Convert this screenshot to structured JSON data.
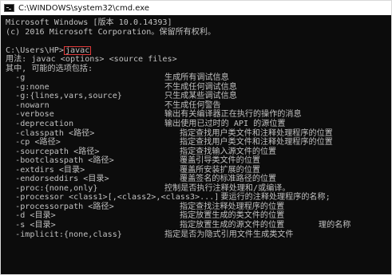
{
  "window": {
    "title": "C:\\WINDOWS\\system32\\cmd.exe"
  },
  "header": {
    "line1": "Microsoft Windows [版本 10.0.14393]",
    "line2": "(c) 2016 Microsoft Corporation。保留所有权利。"
  },
  "prompt": {
    "path": "C:\\Users\\HP>",
    "command": "javac"
  },
  "usage": {
    "line": "用法: javac <options> <source files>",
    "intro": "其中, 可能的选项包括:"
  },
  "options": [
    {
      "flag": "-g",
      "desc": "生成所有调试信息",
      "col": 1
    },
    {
      "flag": "-g:none",
      "desc": "不生成任何调试信息",
      "col": 1
    },
    {
      "flag": "-g:{lines,vars,source}",
      "desc": "只生成某些调试信息",
      "col": 1
    },
    {
      "flag": "-nowarn",
      "desc": "不生成任何警告",
      "col": 1
    },
    {
      "flag": "-verbose",
      "desc": "输出有关编译器正在执行的操作的消息",
      "col": 1
    },
    {
      "flag": "-deprecation",
      "desc": "输出使用已过时的 API 的源位置",
      "col": 1
    },
    {
      "flag": "-classpath <路径>",
      "desc": "指定查找用户类文件和注释处理程序的位置",
      "col": 2
    },
    {
      "flag": "-cp <路径>",
      "desc": "指定查找用户类文件和注释处理程序的位置",
      "col": 2
    },
    {
      "flag": "-sourcepath <路径>",
      "desc": "指定查找输入源文件的位置",
      "col": 2
    },
    {
      "flag": "-bootclasspath <路径>",
      "desc": "覆盖引导类文件的位置",
      "col": 2
    },
    {
      "flag": "-extdirs <目录>",
      "desc": "覆盖所安装扩展的位置",
      "col": 2
    },
    {
      "flag": "-endorseddirs <目录>",
      "desc": "覆盖签名的标准路径的位置",
      "col": 2
    },
    {
      "flag": "-proc:{none,only}",
      "desc": "控制是否执行注释处理和/或编译。",
      "col": 3
    },
    {
      "flag": "-processor <class1>[,<class2>,<class3>...]",
      "desc": "要运行的注释处理程序的名称;",
      "col": 0
    },
    {
      "flag": "-processorpath <路径>",
      "desc": "指定查找注释处理程序的位置",
      "col": 2
    },
    {
      "flag": "-d <目录>",
      "desc": "指定放置生成的类文件的位置",
      "col": 2
    },
    {
      "flag": "-s <目录>",
      "desc": "指定放置生成的源文件的位置",
      "col": 2,
      "trail": "理的名称"
    },
    {
      "flag": "-implicit:{none,class}",
      "desc": "指定是否为隐式引用文件生成类文件",
      "col": 3
    }
  ]
}
